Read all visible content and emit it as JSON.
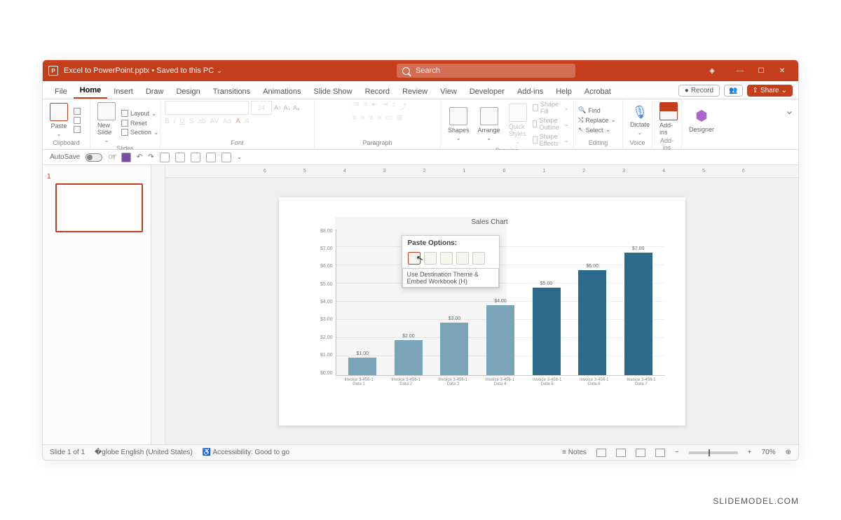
{
  "titlebar": {
    "filename": "Excel to PowerPoint.pptx",
    "save_status": "Saved to this PC",
    "search_placeholder": "Search"
  },
  "tabs": {
    "items": [
      "File",
      "Home",
      "Insert",
      "Draw",
      "Design",
      "Transitions",
      "Animations",
      "Slide Show",
      "Record",
      "Review",
      "View",
      "Developer",
      "Add-ins",
      "Help",
      "Acrobat"
    ],
    "active_index": 1,
    "record_btn": "Record",
    "share_btn": "Share"
  },
  "ribbon": {
    "paste": "Paste",
    "clipboard": "Clipboard",
    "new_slide": "New Slide",
    "layout": "Layout",
    "reset": "Reset",
    "section": "Section",
    "slides": "Slides",
    "font": "Font",
    "font_size": "24",
    "paragraph": "Paragraph",
    "shapes": "Shapes",
    "arrange": "Arrange",
    "quick_styles": "Quick Styles",
    "shape_fill": "Shape Fill",
    "shape_outline": "Shape Outline",
    "shape_effects": "Shape Effects",
    "drawing": "Drawing",
    "find": "Find",
    "replace": "Replace",
    "select": "Select",
    "editing": "Editing",
    "dictate": "Dictate",
    "voice": "Voice",
    "addins": "Add-ins",
    "designer": "Designer"
  },
  "autosave": {
    "label": "AutoSave",
    "state": "Off"
  },
  "slidenav": {
    "number": "1"
  },
  "ruler": {
    "marks": [
      "6",
      "5",
      "4",
      "3",
      "2",
      "1",
      "0",
      "1",
      "2",
      "3",
      "4",
      "5",
      "6"
    ]
  },
  "chart_data": {
    "type": "bar",
    "title": "Sales Chart",
    "categories": [
      "Invoice 3-456-1 Data 1",
      "Invoice 3-456-1 Data 2",
      "Invoice 3-456-1 Data 3",
      "Invoice 3-456-1 Data 4",
      "Invoice 3-456-1 Data 5",
      "Invoice 3-456-1 Data 6",
      "Invoice 3-456-1 Data 7"
    ],
    "values": [
      1.0,
      2.0,
      3.0,
      4.0,
      5.0,
      6.0,
      7.0
    ],
    "value_labels": [
      "$1.00",
      "$2.00",
      "$3.00",
      "$4.00",
      "$5.00",
      "$6.00",
      "$7.00"
    ],
    "yticks": [
      "$8.00",
      "$7.00",
      "$6.00",
      "$5.00",
      "$4.00",
      "$3.00",
      "$2.00",
      "$1.00",
      "$0.00"
    ],
    "ylim": [
      0,
      8
    ],
    "xlabel": "",
    "ylabel": ""
  },
  "paste_popup": {
    "title": "Paste Options:",
    "tooltip": "Use Destination Theme & Embed Workbook (H)"
  },
  "statusbar": {
    "slide": "Slide 1 of 1",
    "lang": "English (United States)",
    "access": "Accessibility: Good to go",
    "notes": "Notes",
    "zoom": "70%"
  },
  "attribution": "SLIDEMODEL.COM"
}
